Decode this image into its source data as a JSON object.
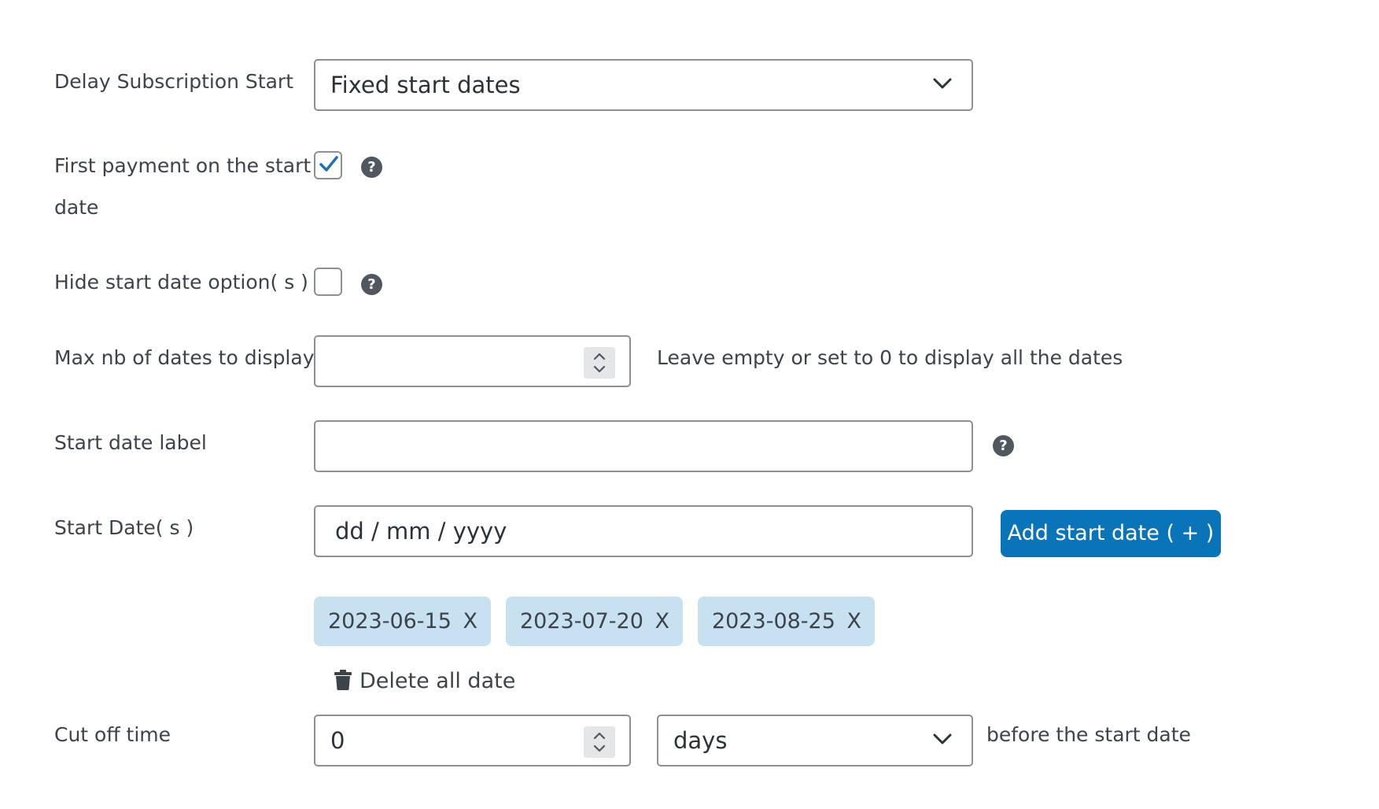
{
  "delay_start": {
    "label": "Delay Subscription Start",
    "selected": "Fixed start dates",
    "icon": "chevron-down-icon"
  },
  "first_payment": {
    "label_line1": "First payment on the start",
    "label_line2": "date",
    "checked": true,
    "help_glyph": "?"
  },
  "hide_start": {
    "label": "Hide start date option( s )",
    "checked": false,
    "help_glyph": "?"
  },
  "max_dates": {
    "label": "Max nb of dates to display",
    "value": "",
    "hint": "Leave empty or set to 0 to display all the dates"
  },
  "start_label": {
    "label": "Start date label",
    "value": "",
    "help_glyph": "?"
  },
  "start_dates": {
    "label": "Start Date( s )",
    "placeholder": "dd / mm / yyyy",
    "add_button": "Add start date ( + )",
    "chips": [
      {
        "date": "2023-06-15",
        "remove": "X"
      },
      {
        "date": "2023-07-20",
        "remove": "X"
      },
      {
        "date": "2023-08-25",
        "remove": "X"
      }
    ],
    "delete_all": "Delete all date"
  },
  "cut_off": {
    "label": "Cut off time",
    "value": "0",
    "unit": "days",
    "suffix": "before the start date"
  },
  "colors": {
    "primary_button": "#0a74b8",
    "chip_bg": "#c7e1f0",
    "checkmark": "#2271b1",
    "help_icon_bg": "#50575e"
  }
}
